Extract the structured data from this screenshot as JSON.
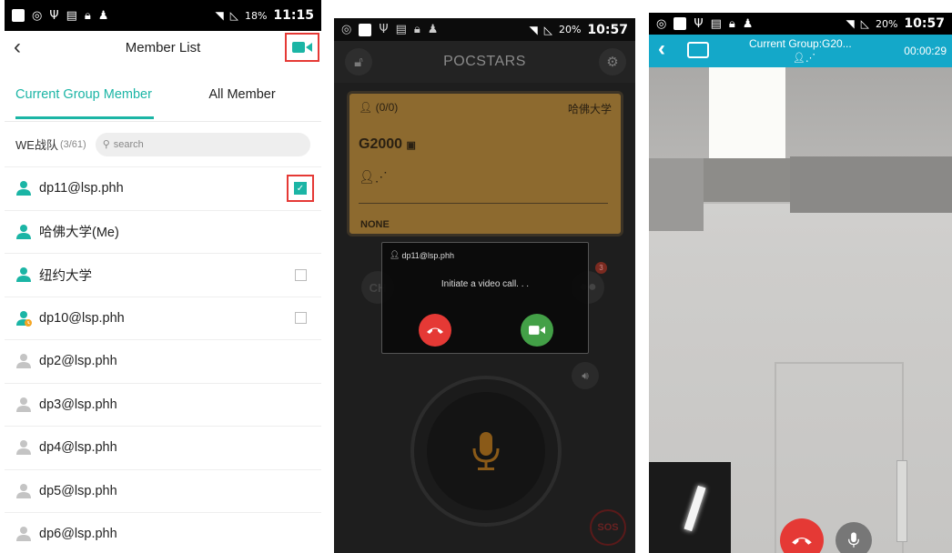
{
  "screen1": {
    "status": {
      "battery": "18%",
      "time": "11:15"
    },
    "header": {
      "title": "Member List"
    },
    "tabs": [
      {
        "label": "Current Group Member"
      },
      {
        "label": "All Member"
      }
    ],
    "group": {
      "name": "WE战队",
      "count": "(3/61)",
      "search_placeholder": "search"
    },
    "members": [
      {
        "name": "dp11@lsp.phh",
        "status": "online",
        "checked": true
      },
      {
        "name": "哈佛大学(Me)",
        "status": "online",
        "checked": null
      },
      {
        "name": "纽约大学",
        "status": "online",
        "checked": false
      },
      {
        "name": "dp10@lsp.phh",
        "status": "away",
        "checked": false
      },
      {
        "name": "dp2@lsp.phh",
        "status": "offline"
      },
      {
        "name": "dp3@lsp.phh",
        "status": "offline"
      },
      {
        "name": "dp4@lsp.phh",
        "status": "offline"
      },
      {
        "name": "dp5@lsp.phh",
        "status": "offline"
      },
      {
        "name": "dp6@lsp.phh",
        "status": "offline"
      }
    ],
    "colors": {
      "accent": "#1bb5a5",
      "highlight": "#e53935"
    }
  },
  "screen2": {
    "status": {
      "battery": "20%",
      "time": "10:57"
    },
    "app_title": "POCSTARS",
    "card": {
      "count": "(0/0)",
      "owner": "哈佛大学",
      "group": "G2000",
      "mode": "NONE"
    },
    "ch_label": "CH",
    "badge": "3",
    "sos_label": "SOS",
    "dialog": {
      "caller": "dp11@lsp.phh",
      "message": "Initiate a video call. . ."
    }
  },
  "screen3": {
    "status": {
      "battery": "20%",
      "time": "10:57"
    },
    "header": {
      "title": "Current Group:G20...",
      "timer": "00:00:29"
    },
    "colors": {
      "header": "#14a8c9"
    }
  }
}
